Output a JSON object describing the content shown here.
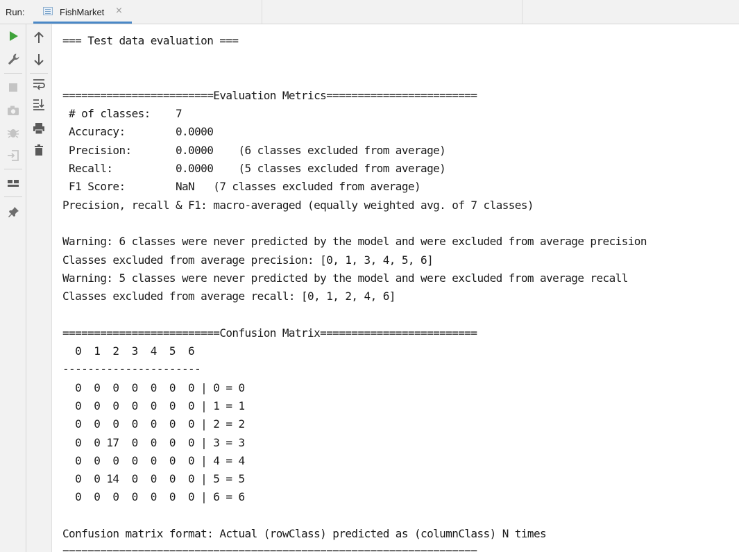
{
  "header": {
    "run_label": "Run:",
    "tab_title": "FishMarket",
    "tab_close": "×"
  },
  "toolbar": {
    "left": [
      "run-icon",
      "wrench-icon",
      "stop-icon",
      "camera-icon",
      "debug-icon",
      "login-icon",
      "layout-icon",
      "pin-icon"
    ],
    "right": [
      "arrow-up-icon",
      "arrow-down-icon",
      "soft-wrap-icon",
      "scroll-to-end-icon",
      "print-icon",
      "trash-icon"
    ]
  },
  "colors": {
    "run_green": "#3fa33a",
    "tab_underline": "#4a88c7",
    "toolbar_bg": "#f2f2f2"
  },
  "console": {
    "lines": [
      "=== Test data evaluation ===",
      "",
      "",
      "========================Evaluation Metrics========================",
      " # of classes:    7",
      " Accuracy:        0.0000",
      " Precision:       0.0000    (6 classes excluded from average)",
      " Recall:          0.0000    (5 classes excluded from average)",
      " F1 Score:        NaN   (7 classes excluded from average)",
      "Precision, recall & F1: macro-averaged (equally weighted avg. of 7 classes)",
      "",
      "Warning: 6 classes were never predicted by the model and were excluded from average precision",
      "Classes excluded from average precision: [0, 1, 3, 4, 5, 6]",
      "Warning: 5 classes were never predicted by the model and were excluded from average recall",
      "Classes excluded from average recall: [0, 1, 2, 4, 6]",
      "",
      "=========================Confusion Matrix=========================",
      "  0  1  2  3  4  5  6",
      "----------------------",
      "  0  0  0  0  0  0  0 | 0 = 0",
      "  0  0  0  0  0  0  0 | 1 = 1",
      "  0  0  0  0  0  0  0 | 2 = 2",
      "  0  0 17  0  0  0  0 | 3 = 3",
      "  0  0  0  0  0  0  0 | 4 = 4",
      "  0  0 14  0  0  0  0 | 5 = 5",
      "  0  0  0  0  0  0  0 | 6 = 6",
      "",
      "Confusion matrix format: Actual (rowClass) predicted as (columnClass) N times",
      "=================================================================="
    ]
  }
}
